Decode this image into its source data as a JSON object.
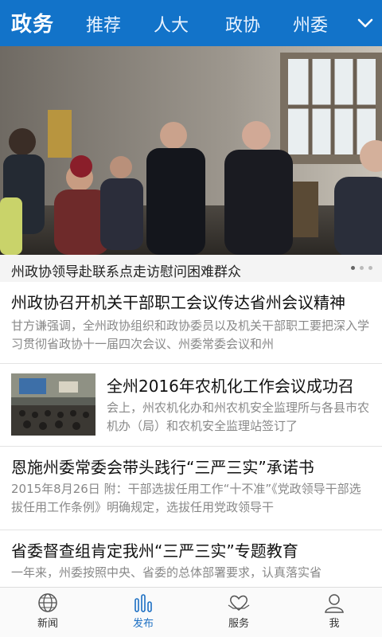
{
  "header": {
    "title": "政务",
    "tabs": [
      "推荐",
      "人大",
      "政协",
      "州委"
    ]
  },
  "hero": {
    "caption": "州政协领导赴联系点走访慰问困难群众"
  },
  "news": [
    {
      "title": "州政协召开机关干部职工会议传达省州会议精神",
      "summary": "甘方谦强调，全州政协组织和政协委员以及机关干部职工要把深入学习贯彻省政协十一届四次会议、州委常委会议和州"
    },
    {
      "title": "全州2016年农机化工作会议成功召",
      "summary": "会上，州农机化办和州农机安全监理所与各县市农机办（局）和农机安全监理站签订了"
    },
    {
      "title": "恩施州委常委会带头践行“三严三实”承诺书",
      "summary": "2015年8月26日 附：干部选拔任用工作“十不准”《党政领导干部选拔任用工作条例》明确规定，选拔任用党政领导干"
    },
    {
      "title": "省委督查组肯定我州“三严三实”专题教育",
      "summary": "一年来，州委按照中央、省委的总体部署要求，认真落实省"
    }
  ],
  "bottom_nav": [
    {
      "label": "新闻",
      "icon": "globe-icon"
    },
    {
      "label": "发布",
      "icon": "bars-icon",
      "active": true
    },
    {
      "label": "服务",
      "icon": "hands-heart-icon"
    },
    {
      "label": "我",
      "icon": "person-icon"
    }
  ],
  "colors": {
    "header_bg": "#1273c9",
    "accent": "#1c6fc3"
  }
}
